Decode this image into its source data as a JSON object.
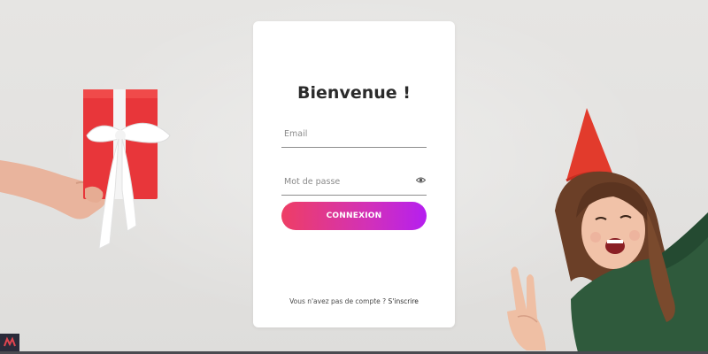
{
  "login": {
    "title": "Bienvenue !",
    "email_placeholder": "Email",
    "password_placeholder": "Mot de passe",
    "submit_label": "CONNEXION",
    "no_account_text": "Vous n'avez pas de compte ?",
    "signup_link": "S'inscrire"
  },
  "icons": {
    "password_toggle": "eye-icon"
  },
  "colors": {
    "background": "#e4e3e1",
    "card": "#ffffff",
    "button_gradient_start": "#ee3e65",
    "button_gradient_end": "#b51ff0",
    "title": "#2b2b2b"
  }
}
